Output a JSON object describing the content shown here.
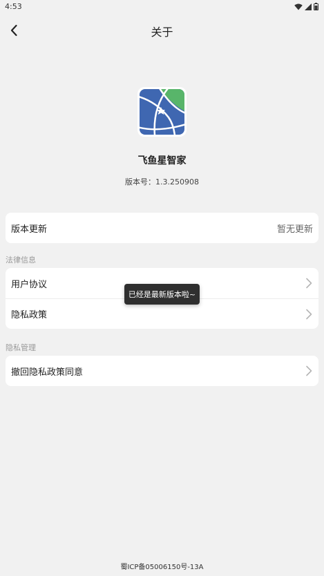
{
  "status_bar": {
    "time": "4:53",
    "icons": [
      "wifi-icon",
      "signal-icon",
      "battery-icon"
    ]
  },
  "app_bar": {
    "title": "关于",
    "back_icon": "chevron-left-icon"
  },
  "app_info": {
    "logo_icon": "feiyuxing-logo",
    "name": "飞鱼星智家",
    "version": "版本号：1.3.250908"
  },
  "update_card": {
    "label": "版本更新",
    "value": "暂无更新"
  },
  "legal_section": {
    "title": "法律信息",
    "items": [
      {
        "label": "用户协议"
      },
      {
        "label": "隐私政策"
      }
    ]
  },
  "privacy_section": {
    "title": "隐私管理",
    "items": [
      {
        "label": "撤回隐私政策同意"
      }
    ]
  },
  "toast": {
    "message": "已经是最新版本啦~"
  },
  "footer": {
    "icp": "蜀ICP备05006150号-13A"
  },
  "colors": {
    "background": "#f1f1f1",
    "card": "#ffffff",
    "logo_blue": "#3f67b1",
    "logo_green": "#58b56a",
    "toast_bg": "#2f2f2f"
  }
}
